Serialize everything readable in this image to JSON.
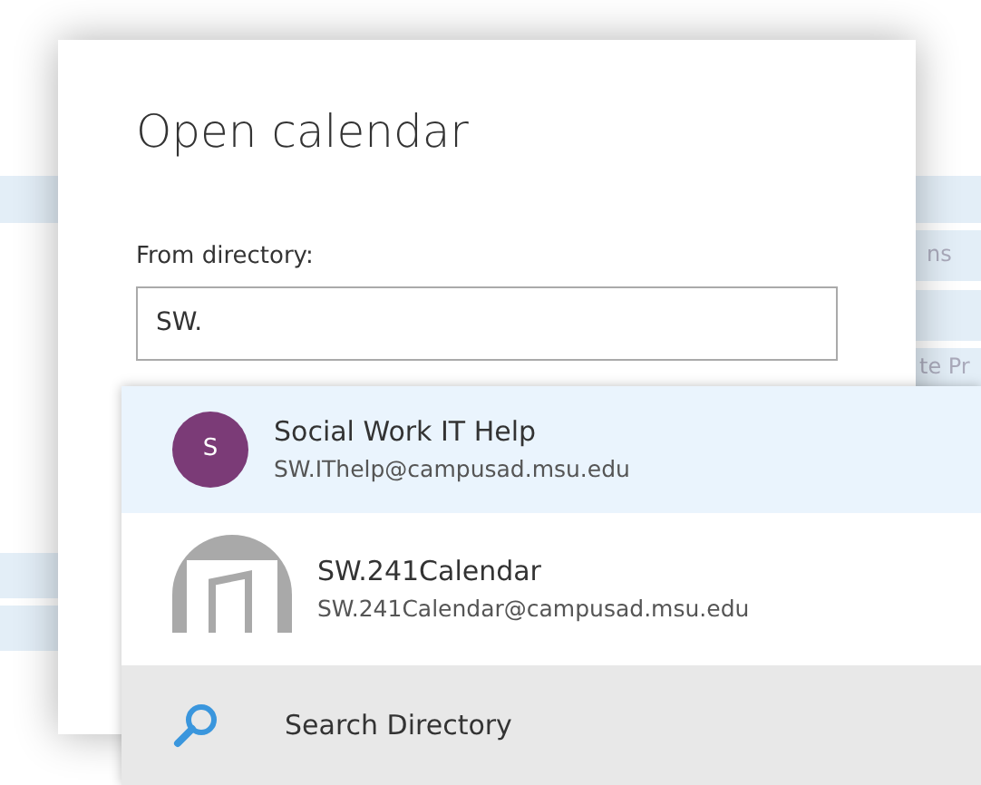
{
  "background": {
    "fragments": [
      "ns",
      "te Pr"
    ]
  },
  "dialog": {
    "title": "Open calendar",
    "field_label": "From directory:",
    "field_value": "SW."
  },
  "suggestions": [
    {
      "kind": "person",
      "initial": "S",
      "color": "#7b3b77",
      "name": "Social Work IT Help",
      "email": "SW.IThelp@campusad.msu.edu",
      "selected": true
    },
    {
      "kind": "resource",
      "name": "SW.241Calendar",
      "email": "SW.241Calendar@campusad.msu.edu",
      "selected": false
    }
  ],
  "search_action": {
    "label": "Search Directory"
  }
}
